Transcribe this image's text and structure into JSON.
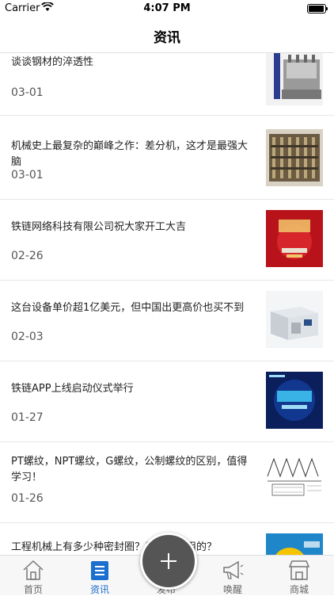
{
  "status": {
    "carrier": "Carrier",
    "time": "4:07 PM"
  },
  "nav": {
    "title": "资讯"
  },
  "news": [
    {
      "title": "谈谈钢材的淬透性",
      "date": "03-01",
      "thumb": "machine-test-rig"
    },
    {
      "title": "机械史上最复杂的巅峰之作：差分机，这才是最强大脑",
      "date": "03-01",
      "thumb": "difference-engine"
    },
    {
      "title": "铁链网络科技有限公司祝大家开工大吉",
      "date": "02-26",
      "thumb": "new-year-poster"
    },
    {
      "title": "这台设备单价超1亿美元，但中国出更高价也买不到",
      "date": "02-03",
      "thumb": "lithography-machine"
    },
    {
      "title": "铁链APP上线启动仪式举行",
      "date": "01-27",
      "thumb": "app-launch-poster"
    },
    {
      "title": "PT螺纹，NPT螺纹，G螺纹，公制螺纹的区别，值得学习！",
      "date": "01-26",
      "thumb": "thread-diagram"
    },
    {
      "title": "工程机械上有多少种密封圈？都是干嘛用的？",
      "date": "",
      "thumb": "seal-rings"
    }
  ],
  "tabs": [
    {
      "label": "首页",
      "icon": "home-icon"
    },
    {
      "label": "资讯",
      "icon": "news-icon",
      "active": true
    },
    {
      "label": "发布",
      "icon": "plus-icon"
    },
    {
      "label": "唤醒",
      "icon": "megaphone-icon"
    },
    {
      "label": "商城",
      "icon": "shop-icon"
    }
  ],
  "colors": {
    "accent": "#1c6fcf",
    "tab_bg": "#f7f7f7",
    "fab": "#555555"
  }
}
